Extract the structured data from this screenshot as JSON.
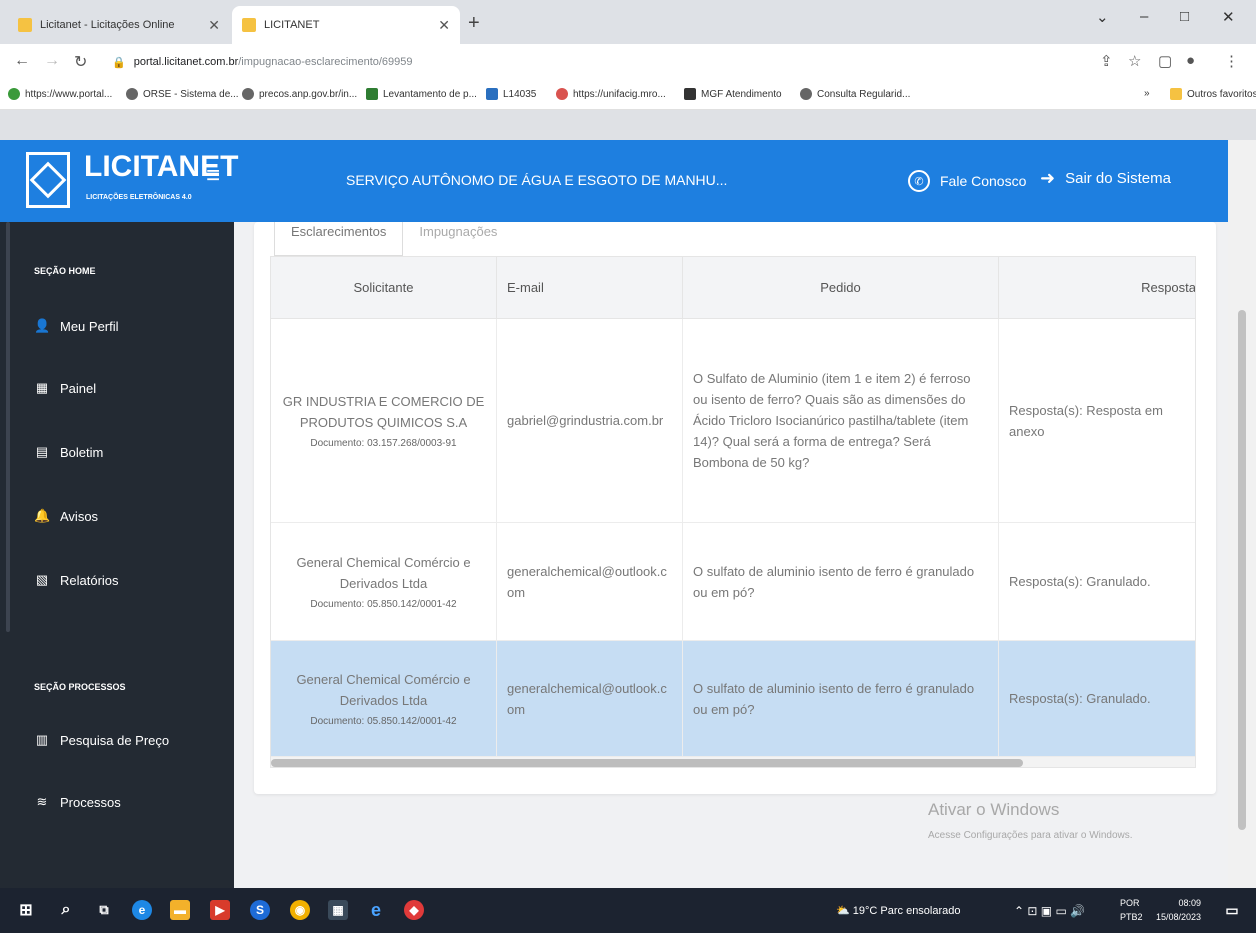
{
  "browser": {
    "tabs": [
      {
        "title": "Licitanet - Licitações Online",
        "active": false
      },
      {
        "title": "LICITANET",
        "active": true
      }
    ],
    "new_tab": "+",
    "window_controls": {
      "minimize": "–",
      "maximize": "□",
      "close": "✕",
      "menu": "⌄"
    },
    "address": {
      "host": "portal.licitanet.com.br",
      "path": "/impugnacao-esclarecimento/69959"
    },
    "bookmarks": [
      "https://www.portal...",
      "ORSE - Sistema de...",
      "precos.anp.gov.br/in...",
      "Levantamento de p...",
      "L14035",
      "https://unifacig.mro...",
      "MGF Atendimento",
      "Consulta Regularid..."
    ],
    "bookmarks_more": "»",
    "bookmarks_other": "Outros favoritos"
  },
  "header": {
    "brand": "LICITANET",
    "brand_sub": "LICITAÇÕES ELETRÔNICAS 4.0",
    "organization": "SERVIÇO AUTÔNOMO DE ÁGUA E ESGOTO DE MANHU...",
    "contact_label": "Fale Conosco",
    "logout_label": "Sair do Sistema",
    "color": "#1e7fe0"
  },
  "sidebar": {
    "section_home": "SEÇÃO HOME",
    "home_items": [
      "Meu Perfil",
      "Painel",
      "Boletim",
      "Avisos",
      "Relatórios"
    ],
    "section_processes": "SEÇÃO PROCESSOS",
    "process_items": [
      "Pesquisa de Preço",
      "Processos"
    ]
  },
  "tabs": [
    "Esclarecimentos",
    "Impugnações"
  ],
  "table": {
    "headers": [
      "Solicitante",
      "E-mail",
      "Pedido",
      "Resposta"
    ],
    "rows": [
      {
        "solicitante": "GR INDUSTRIA E COMERCIO DE PRODUTOS QUIMICOS S.A",
        "documento": "Documento: 03.157.268/0003-91",
        "email": "gabriel@grindustria.com.br",
        "pedido": "O Sulfato de Aluminio (item 1 e item 2) é ferroso ou isento de ferro? Quais são as dimensões do Ácido Tricloro Isocianúrico pastilha/tablete (item 14)? Qual será a forma de entrega? Será Bombona de 50 kg?",
        "resposta": "Resposta(s): Resposta em anexo"
      },
      {
        "solicitante": "General Chemical Comércio e Derivados Ltda",
        "documento": "Documento: 05.850.142/0001-42",
        "email": "generalchemical@outlook.com",
        "pedido": "O sulfato de aluminio isento de ferro é granulado ou em pó?",
        "resposta": "Resposta(s): Granulado."
      },
      {
        "solicitante": "General Chemical Comércio e Derivados Ltda",
        "documento": "Documento: 05.850.142/0001-42",
        "email": "generalchemical@outlook.com",
        "pedido": "O sulfato de aluminio isento de ferro é granulado ou em pó?",
        "resposta": "Resposta(s): Granulado."
      }
    ]
  },
  "watermark": {
    "title": "Ativar o Windows",
    "subtitle": "Acesse Configurações para ativar o Windows."
  },
  "taskbar": {
    "weather": "19°C  Parc ensolarado",
    "lang_1": "POR",
    "lang_2": "PTB2",
    "time": "08:09",
    "date": "15/08/2023"
  }
}
